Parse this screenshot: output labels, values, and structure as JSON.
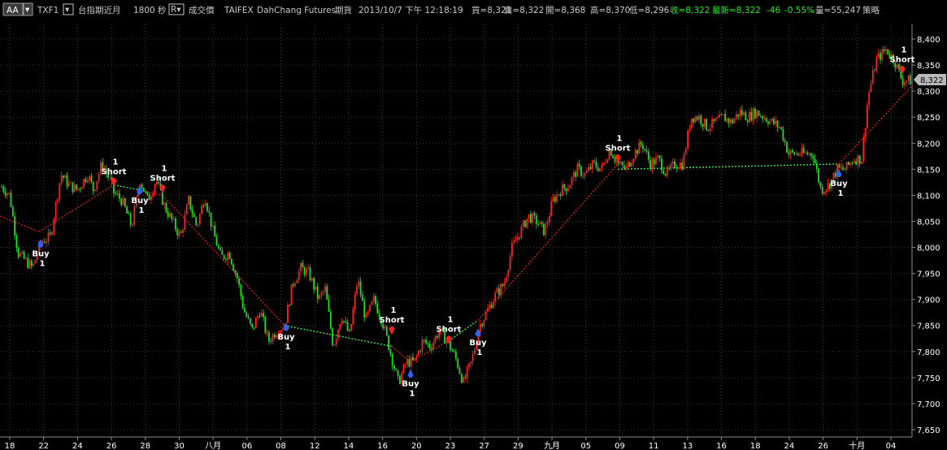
{
  "header": {
    "selector_label": "AA",
    "symbol": "TXF1",
    "contract_name": "台指期近月",
    "interval": "1800 秒",
    "price_type": "成交價",
    "exchange": "TAIFEX",
    "broker": "DahChang Futures",
    "market": "期貨",
    "datetime": "2013/10/7 下午 12:18:19",
    "bid": "買=8,321",
    "ask": "賣=8,322",
    "open": "開=8,368",
    "high": "高=8,370",
    "low": "低=8,296",
    "close": "收=8,322",
    "latest": "最新=8,322",
    "change": "-46",
    "change_pct": "-0.55%",
    "volume": "量=55,247",
    "strategy": "策略"
  },
  "colors": {
    "background": "#000000",
    "grid": "#3a3a3a",
    "up_bar": "#ff2020",
    "down_bar": "#22dd22",
    "buy_marker": "#3060ff",
    "short_marker": "#ff2020",
    "trend_dn_line": "#cc2020",
    "trend_up_line": "#44ee44",
    "header_text": "#c8c8c8",
    "header_green": "#22ee22"
  },
  "chart_data": {
    "type": "ohlc",
    "y_ticks": [
      "8,400",
      "8,350",
      "8,300",
      "8,250",
      "8,200",
      "8,150",
      "8,100",
      "8,050",
      "8,000",
      "7,950",
      "7,900",
      "7,850",
      "7,800",
      "7,750",
      "7,700",
      "7,650"
    ],
    "ylim": [
      7650,
      8400
    ],
    "x_ticks": [
      "18",
      "22",
      "24",
      "26",
      "28",
      "30",
      "八月",
      "06",
      "08",
      "12",
      "14",
      "16",
      "20",
      "23",
      "27",
      "29",
      "九月",
      "05",
      "09",
      "11",
      "13",
      "16",
      "18",
      "24",
      "26",
      "十月",
      "04"
    ],
    "last_price_label": "8,322",
    "last_price": 8322,
    "anchors": [
      [
        0,
        8120
      ],
      [
        12,
        8100
      ],
      [
        22,
        7990
      ],
      [
        40,
        7960
      ],
      [
        50,
        8010
      ],
      [
        62,
        8020
      ],
      [
        75,
        8140
      ],
      [
        85,
        8120
      ],
      [
        95,
        8110
      ],
      [
        108,
        8140
      ],
      [
        115,
        8110
      ],
      [
        125,
        8160
      ],
      [
        135,
        8130
      ],
      [
        140,
        8105
      ],
      [
        150,
        8090
      ],
      [
        162,
        8040
      ],
      [
        172,
        8130
      ],
      [
        182,
        8090
      ],
      [
        192,
        8130
      ],
      [
        202,
        8080
      ],
      [
        212,
        8050
      ],
      [
        222,
        8020
      ],
      [
        232,
        8090
      ],
      [
        242,
        8040
      ],
      [
        252,
        8100
      ],
      [
        262,
        8030
      ],
      [
        272,
        7980
      ],
      [
        282,
        7990
      ],
      [
        292,
        7940
      ],
      [
        300,
        7880
      ],
      [
        310,
        7840
      ],
      [
        320,
        7880
      ],
      [
        330,
        7820
      ],
      [
        340,
        7840
      ],
      [
        350,
        7850
      ],
      [
        360,
        7930
      ],
      [
        370,
        7960
      ],
      [
        380,
        7950
      ],
      [
        392,
        7900
      ],
      [
        400,
        7920
      ],
      [
        410,
        7810
      ],
      [
        420,
        7870
      ],
      [
        430,
        7830
      ],
      [
        440,
        7940
      ],
      [
        450,
        7860
      ],
      [
        460,
        7900
      ],
      [
        470,
        7860
      ],
      [
        480,
        7800
      ],
      [
        490,
        7740
      ],
      [
        500,
        7780
      ],
      [
        510,
        7780
      ],
      [
        520,
        7820
      ],
      [
        530,
        7810
      ],
      [
        540,
        7840
      ],
      [
        550,
        7820
      ],
      [
        560,
        7790
      ],
      [
        570,
        7740
      ],
      [
        580,
        7780
      ],
      [
        590,
        7850
      ],
      [
        600,
        7880
      ],
      [
        610,
        7910
      ],
      [
        620,
        7930
      ],
      [
        630,
        8000
      ],
      [
        640,
        8030
      ],
      [
        650,
        8060
      ],
      [
        660,
        8050
      ],
      [
        670,
        8030
      ],
      [
        680,
        8090
      ],
      [
        690,
        8110
      ],
      [
        700,
        8120
      ],
      [
        710,
        8150
      ],
      [
        720,
        8140
      ],
      [
        730,
        8160
      ],
      [
        740,
        8150
      ],
      [
        750,
        8190
      ],
      [
        760,
        8160
      ],
      [
        770,
        8150
      ],
      [
        780,
        8180
      ],
      [
        790,
        8200
      ],
      [
        800,
        8160
      ],
      [
        810,
        8170
      ],
      [
        820,
        8140
      ],
      [
        830,
        8160
      ],
      [
        840,
        8160
      ],
      [
        850,
        8250
      ],
      [
        860,
        8250
      ],
      [
        870,
        8230
      ],
      [
        880,
        8240
      ],
      [
        890,
        8250
      ],
      [
        900,
        8240
      ],
      [
        910,
        8260
      ],
      [
        920,
        8250
      ],
      [
        930,
        8260
      ],
      [
        940,
        8250
      ],
      [
        950,
        8240
      ],
      [
        960,
        8230
      ],
      [
        970,
        8180
      ],
      [
        980,
        8180
      ],
      [
        990,
        8180
      ],
      [
        1000,
        8180
      ],
      [
        1010,
        8110
      ],
      [
        1020,
        8120
      ],
      [
        1030,
        8150
      ],
      [
        1040,
        8150
      ],
      [
        1050,
        8170
      ],
      [
        1060,
        8170
      ],
      [
        1068,
        8290
      ],
      [
        1078,
        8360
      ],
      [
        1090,
        8380
      ],
      [
        1100,
        8360
      ],
      [
        1110,
        8320
      ],
      [
        1122,
        8320
      ]
    ],
    "trend_segments": [
      {
        "dir": "down",
        "from": [
          0,
          8060
        ],
        "to": [
          48,
          8030
        ]
      },
      {
        "dir": "down",
        "from": [
          48,
          8030
        ],
        "to": [
          140,
          8120
        ]
      },
      {
        "dir": "up",
        "from": [
          140,
          8120
        ],
        "to": [
          172,
          8110
        ]
      },
      {
        "dir": "down",
        "from": [
          172,
          8110
        ],
        "to": [
          200,
          8100
        ]
      },
      {
        "dir": "down",
        "from": [
          200,
          8100
        ],
        "to": [
          350,
          7850
        ]
      },
      {
        "dir": "up",
        "from": [
          350,
          7850
        ],
        "to": [
          482,
          7810
        ]
      },
      {
        "dir": "down",
        "from": [
          482,
          7810
        ],
        "to": [
          504,
          7780
        ]
      },
      {
        "dir": "down",
        "from": [
          504,
          7780
        ],
        "to": [
          552,
          7820
        ]
      },
      {
        "dir": "up",
        "from": [
          552,
          7820
        ],
        "to": [
          588,
          7860
        ]
      },
      {
        "dir": "down",
        "from": [
          588,
          7860
        ],
        "to": [
          760,
          8160
        ]
      },
      {
        "dir": "up",
        "from": [
          760,
          8150
        ],
        "to": [
          1032,
          8160
        ]
      },
      {
        "dir": "down",
        "from": [
          1032,
          8160
        ],
        "to": [
          1122,
          8310
        ]
      }
    ],
    "signals": [
      {
        "type": "buy",
        "x": 50,
        "price": 8008,
        "label": "Buy",
        "qty": "1"
      },
      {
        "type": "short",
        "x": 140,
        "price": 8125,
        "label": "Short",
        "qty": "1"
      },
      {
        "type": "buy",
        "x": 172,
        "price": 8110,
        "label": "Buy",
        "qty": "1"
      },
      {
        "type": "short",
        "x": 200,
        "price": 8112,
        "label": "Short",
        "qty": "1"
      },
      {
        "type": "buy",
        "x": 352,
        "price": 7848,
        "label": "Buy",
        "qty": "1"
      },
      {
        "type": "short",
        "x": 482,
        "price": 7840,
        "label": "Short",
        "qty": "1"
      },
      {
        "type": "buy",
        "x": 505,
        "price": 7758,
        "label": "Buy",
        "qty": "1"
      },
      {
        "type": "short",
        "x": 552,
        "price": 7822,
        "label": "Short",
        "qty": "1"
      },
      {
        "type": "buy",
        "x": 588,
        "price": 7837,
        "label": "Buy",
        "qty": "1"
      },
      {
        "type": "short",
        "x": 760,
        "price": 8170,
        "label": "Short",
        "qty": "1"
      },
      {
        "type": "buy",
        "x": 1032,
        "price": 8143,
        "label": "Buy",
        "qty": "1"
      },
      {
        "type": "short",
        "x": 1110,
        "price": 8340,
        "label": "Short",
        "qty": "1"
      }
    ]
  }
}
